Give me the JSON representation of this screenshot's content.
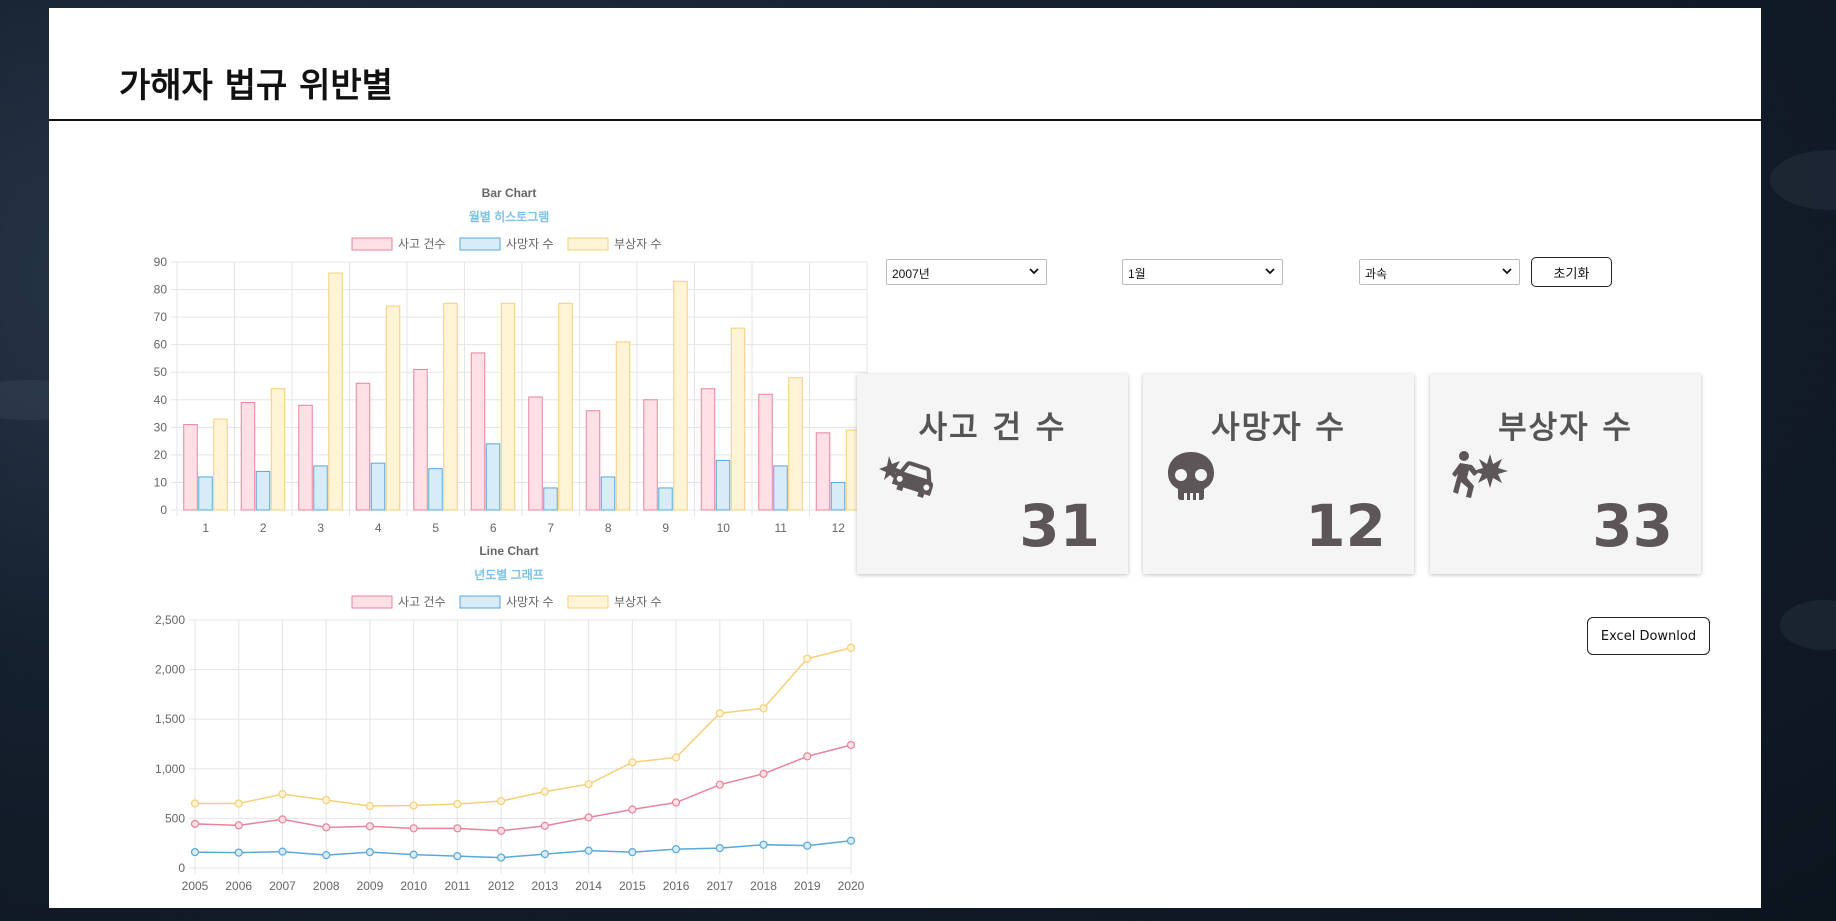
{
  "page": {
    "title": "가해자 법규 위반별"
  },
  "controls": {
    "year": "2007년",
    "month": "1월",
    "violation": "과속",
    "reset_label": "초기화",
    "excel_label": "Excel Downlod"
  },
  "cards": [
    {
      "title": "사고 건 수",
      "value": "31",
      "icon": "car-crash-icon"
    },
    {
      "title": "사망자 수",
      "value": "12",
      "icon": "skull-icon"
    },
    {
      "title": "부상자 수",
      "value": "33",
      "icon": "person-injury-icon"
    }
  ],
  "colors": {
    "accidents": "#e8849b",
    "accidents_fill": "#ffe0e6",
    "deaths": "#5aa8d9",
    "deaths_fill": "#d7ecf8",
    "injuries": "#f5d07a",
    "injuries_fill": "#fff4d6"
  },
  "chart_data": [
    {
      "type": "bar",
      "title": "Bar Chart",
      "subtitle": "월별 히스토그램",
      "categories": [
        "1",
        "2",
        "3",
        "4",
        "5",
        "6",
        "7",
        "8",
        "9",
        "10",
        "11",
        "12"
      ],
      "series": [
        {
          "name": "사고 건수",
          "values": [
            31,
            39,
            38,
            46,
            51,
            57,
            41,
            36,
            40,
            44,
            42,
            28
          ]
        },
        {
          "name": "사망자 수",
          "values": [
            12,
            14,
            16,
            17,
            15,
            24,
            8,
            12,
            8,
            18,
            16,
            10
          ]
        },
        {
          "name": "부상자 수",
          "values": [
            33,
            44,
            86,
            74,
            75,
            75,
            75,
            61,
            83,
            66,
            48,
            29
          ]
        }
      ],
      "ylim": [
        0,
        90
      ],
      "yticks": [
        0,
        10,
        20,
        30,
        40,
        50,
        60,
        70,
        80,
        90
      ],
      "legend": "top",
      "grid": true
    },
    {
      "type": "line",
      "title": "Line Chart",
      "subtitle": "년도별 그래프",
      "categories": [
        "2005",
        "2006",
        "2007",
        "2008",
        "2009",
        "2010",
        "2011",
        "2012",
        "2013",
        "2014",
        "2015",
        "2016",
        "2017",
        "2018",
        "2019",
        "2020"
      ],
      "series": [
        {
          "name": "사고 건수",
          "values": [
            445,
            430,
            490,
            410,
            420,
            400,
            400,
            375,
            425,
            510,
            590,
            660,
            840,
            950,
            1125,
            1240
          ]
        },
        {
          "name": "사망자 수",
          "values": [
            160,
            155,
            165,
            130,
            160,
            135,
            120,
            105,
            140,
            175,
            160,
            190,
            200,
            235,
            225,
            275
          ]
        },
        {
          "name": "부상자 수",
          "values": [
            650,
            650,
            745,
            685,
            625,
            630,
            645,
            675,
            770,
            845,
            1065,
            1115,
            1560,
            1610,
            2110,
            2220
          ]
        }
      ],
      "ylim": [
        0,
        2500
      ],
      "yticks": [
        "0",
        "500",
        "1,000",
        "1,500",
        "2,000",
        "2,500"
      ],
      "legend": "top",
      "grid": true
    }
  ]
}
